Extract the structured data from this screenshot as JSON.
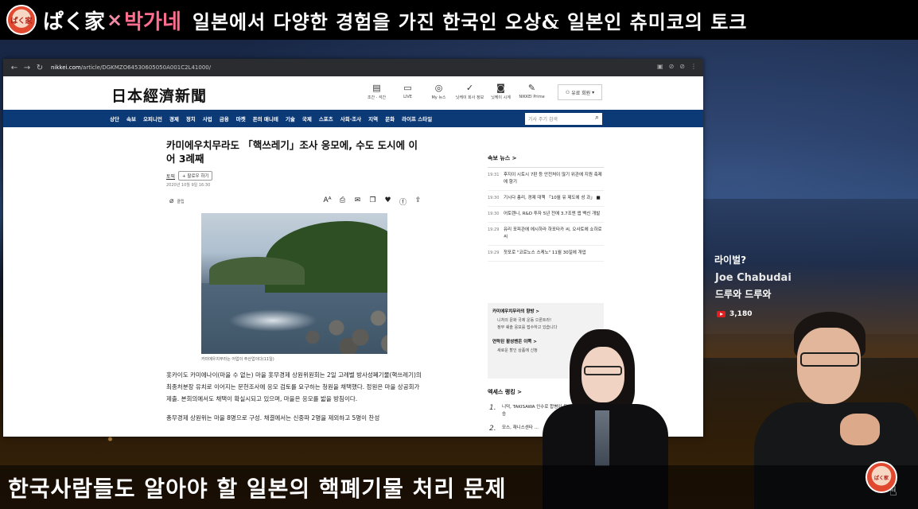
{
  "banner": {
    "logo_text": "ぱく家",
    "brand_a": "ぱく家",
    "brand_x": "×",
    "brand_b": "박가네",
    "title": "일본에서 다양한 경험을 가진 한국인 오상& 일본인 츄미코의 토크"
  },
  "caption": "한국사람들도 알아야 할 일본의 핵폐기물 처리 문제",
  "browser": {
    "url_host": "nikkei.com",
    "url_path": "/article/DGKMZO64530605050A001C2L41000/",
    "site_logo": "日本經濟新聞",
    "header_icons": [
      {
        "icon": "calendar-icon",
        "label": "조간 · 석간"
      },
      {
        "icon": "video-icon",
        "label": "LIVE"
      },
      {
        "icon": "user-icon",
        "label": "My 뉴스"
      },
      {
        "icon": "check-icon",
        "label": "닛케이 회사 정보"
      },
      {
        "icon": "globe-icon",
        "label": "닛케이 시계"
      },
      {
        "icon": "nikkei-prime-icon",
        "label": "NIKKEI Prime"
      }
    ],
    "login_label": "유료 회원",
    "nav": [
      "상단",
      "속보",
      "오피니언",
      "경제",
      "정치",
      "사업",
      "금융",
      "마켓",
      "돈의 매니테",
      "기술",
      "국제",
      "스포츠",
      "사회·조사",
      "지역",
      "문화",
      "라이프 스타일"
    ],
    "search_placeholder": "기사 주기 검색"
  },
  "article": {
    "title": "카미에우치무라도 「핵쓰레기」조사 응모에, 수도 도시에 이어 3례째",
    "topic": "토픽",
    "follow": "+ 팔로우 하기",
    "date": "2020년 10월 9일 16:30",
    "clip_label": "클립",
    "share_icons": [
      "font-size-icon",
      "print-icon",
      "mail-icon",
      "copy-icon",
      "twitter-icon",
      "facebook-icon",
      "share-icon"
    ],
    "photo_caption": "카미에우치무라는 어업이 주산업이다(11일)",
    "paragraphs": [
      "홋카이도 카미에나이(마을 수 없는) 마을 홋무경제 상원위원회는 2일 고레벨 방사성폐기물(핵쓰레기)의 최종처분장 유치로 이어지는 문헌조사에 응모 검토를 요구하는 청원을 채택했다. 정원은 마을 상공회가 제출. 본회의에서도 채택이 확실시되고 있으며, 마을은 응모를 밟을 방침이다.",
      "총무경제 상원위는 마을 8명으로 구성. 채결에서는 신중파 2명을 제외하고 5명이 찬성"
    ]
  },
  "sidebar": {
    "breaking_head": "속보 뉴스 >",
    "news": [
      {
        "time": "19:31",
        "text": "후지이 시토시 7판 등 안전처이 많기 위관에 지원 축제에 향기"
      },
      {
        "time": "19:30",
        "text": "기시다 총리, 경제 대책 「10월 유 제도에 성 과」 ■"
      },
      {
        "time": "19:30",
        "text": "어토렌니, R&D 투자 5년 전에 3.7조엔 앱 백신 개발"
      },
      {
        "time": "19:29",
        "text": "유리 포피관에 에시하라 하포타카 씨, 오사토에 쇼하로 씨"
      },
      {
        "time": "19:29",
        "text": "잣포로 \"코로노스 스케노\" 11월 30일에 개업"
      }
    ],
    "box1_title": "카미에우치무라의 향방 >",
    "box1_lines": [
      "니처의 문화 국제 운동 으론트라!",
      "정부 쉐솔 응모를 접수하고 있습니다"
    ],
    "box2_title": "연락된 활성벤은 이쪽 >",
    "box2_lines": [
      "새로운 할인 상품에 신청"
    ],
    "access_head": "엑세스 랭킹 >",
    "ranking": [
      {
        "n": "1.",
        "text": "니덕, TAKISAWA 인수로 합병이 음?주승"
      },
      {
        "n": "2.",
        "text": "모스, 재니스센타 ..."
      }
    ]
  },
  "overlay": {
    "rival_question": "라이벌?",
    "viewer_name": "Joe Chabudai",
    "viewer_sub": "드루와 드루와",
    "yt_count": "3,180"
  }
}
